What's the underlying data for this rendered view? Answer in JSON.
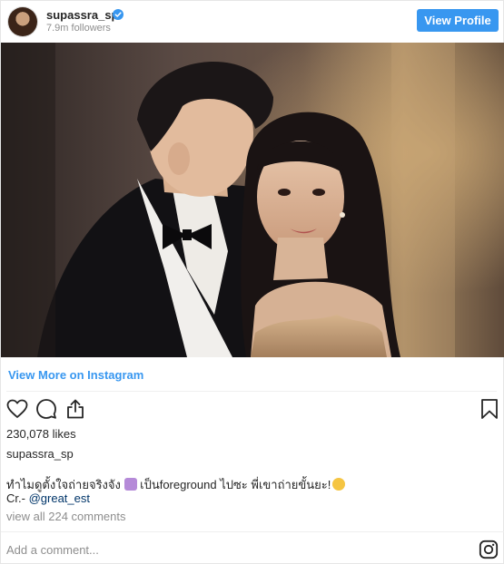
{
  "header": {
    "username": "supassra_sp",
    "followers": "7.9m followers",
    "view_profile_label": "View Profile"
  },
  "post": {
    "view_more_label": "View More on Instagram",
    "likes": "230,078 likes",
    "caption_user": "supassra_sp",
    "caption_part1": "ทำไมดูตั้งใจถ่ายจริงจัง",
    "caption_part2": "เป็นforeground ไปซะ พี่เขาถ่ายขั้นยะ!",
    "credit_prefix": "Cr.-",
    "credit_mention": "@great_est",
    "view_comments": "view all 224 comments",
    "add_comment_placeholder": "Add a comment..."
  },
  "icons": {
    "verified": "verified-badge-icon",
    "like": "heart-icon",
    "comment": "comment-bubble-icon",
    "share": "share-icon",
    "save": "bookmark-icon",
    "brand": "instagram-logo-icon"
  },
  "colors": {
    "accent": "#3897f0",
    "muted": "#8e8e8e",
    "text": "#262626",
    "mention": "#003569"
  }
}
